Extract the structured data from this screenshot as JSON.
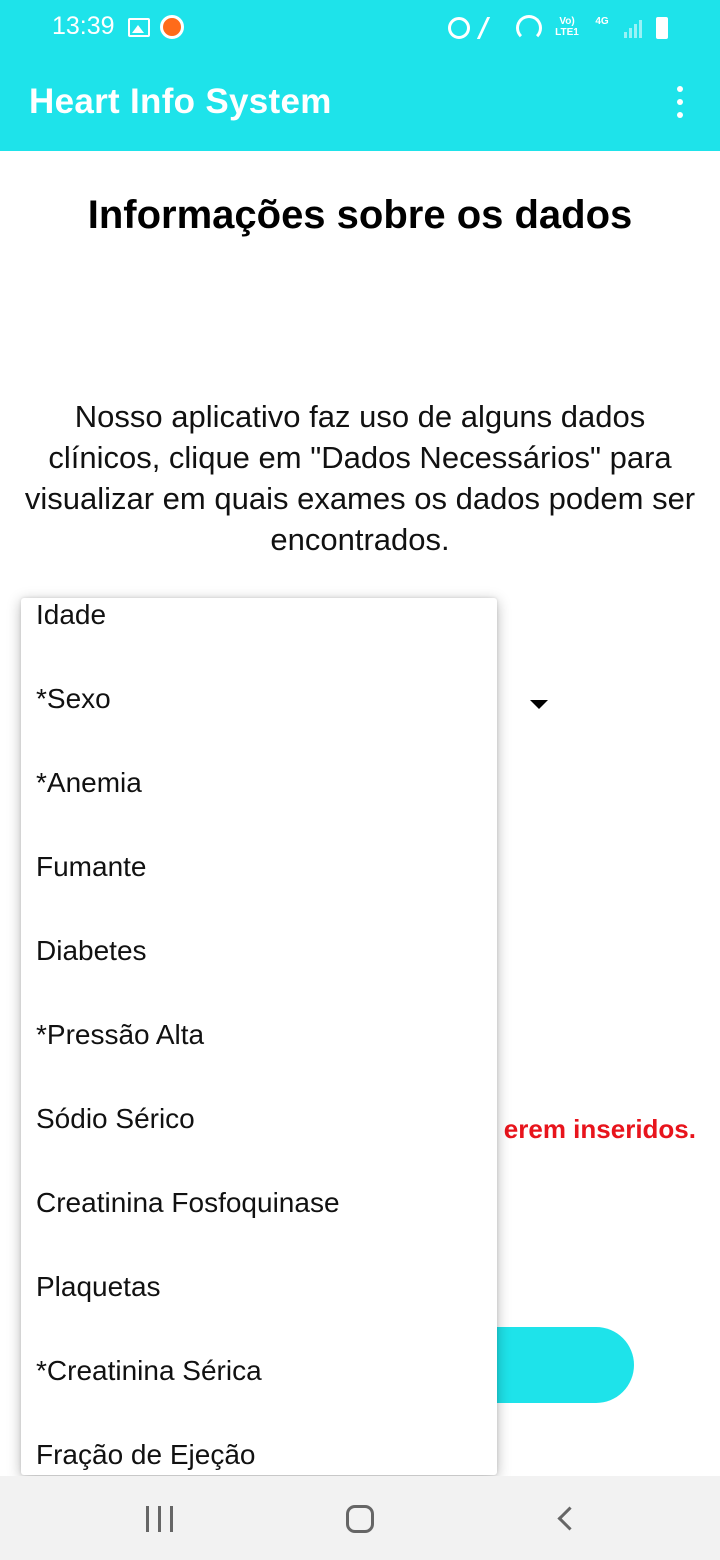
{
  "status_bar": {
    "time": "13:39",
    "icons": [
      "gallery-icon",
      "notification-icon",
      "alarm-icon",
      "vibrate-mute-icon",
      "hotspot-icon",
      "volte-icon",
      "4g-icon",
      "signal-icon",
      "battery-icon"
    ],
    "volte_label": "Vo) LTE1",
    "network_label": "4G"
  },
  "app_bar": {
    "title": "Heart Info System",
    "menu_icon": "overflow-menu-icon",
    "color": "#1ee3ea"
  },
  "main": {
    "title": "Informações sobre os dados",
    "intro": "Nosso aplicativo faz uso de alguns dados clínicos, clique em \"Dados Necessários\" para visualizar em quais exames os dados podem ser encontrados.",
    "warning_partial": "erem inseridos.",
    "warning_color": "#e8141c"
  },
  "dropdown": {
    "options": [
      "Idade",
      "*Sexo",
      "*Anemia",
      "Fumante",
      "Diabetes",
      "*Pressão Alta",
      "Sódio Sérico",
      "Creatinina Fosfoquinase",
      "Plaquetas",
      "*Creatinina Sérica",
      "Fração de Ejeção"
    ]
  },
  "nav_bar": {
    "icons": [
      "recents-icon",
      "home-icon",
      "back-icon"
    ]
  }
}
